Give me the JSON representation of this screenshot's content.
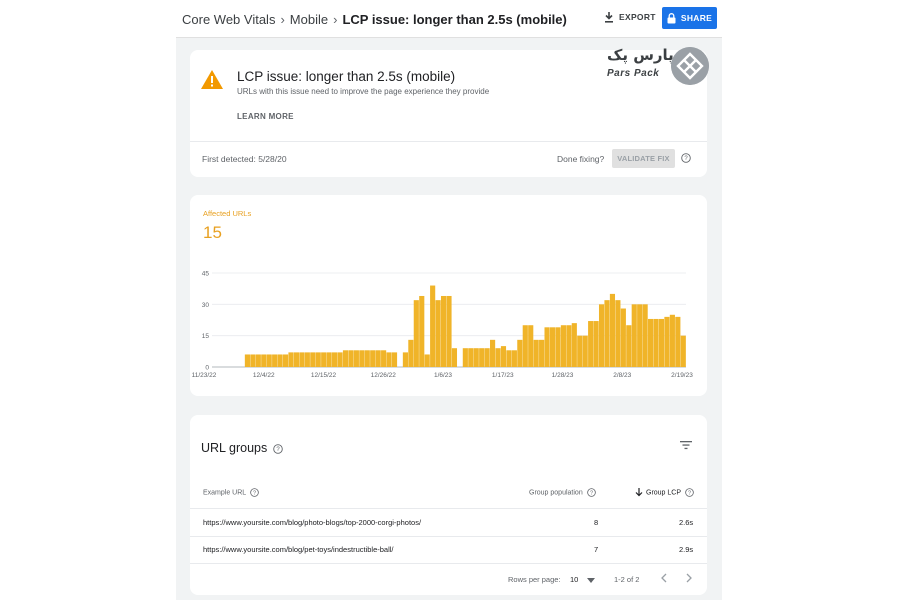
{
  "breadcrumb": [
    "Core Web Vitals",
    "Mobile",
    "LCP issue: longer than 2.5s (mobile)"
  ],
  "toolbar": {
    "export_label": "EXPORT",
    "share_label": "SHARE"
  },
  "issue": {
    "title": "LCP issue: longer than 2.5s (mobile)",
    "description": "URLs with this issue need to improve the page experience they provide",
    "learn_more": "LEARN MORE",
    "first_detected": "First detected: 5/28/20",
    "done_fixing": "Done fixing?",
    "validate_label": "VALIDATE FIX"
  },
  "logo": {
    "persian_text": "پارس پک",
    "latin_text": "Pars Pack"
  },
  "summary": {
    "affected_label": "Affected URLs",
    "affected_value": "15"
  },
  "colors": {
    "accent": "#1a73e8",
    "bar": "#f0b429",
    "warning": "#f29900"
  },
  "chart_data": {
    "type": "bar",
    "yticks": [
      0,
      15,
      30,
      45
    ],
    "ylim": [
      0,
      45
    ],
    "xticks": [
      "11/23/22",
      "12/4/22",
      "12/15/22",
      "12/26/22",
      "1/6/23",
      "1/17/23",
      "1/28/23",
      "2/8/23",
      "2/19/23"
    ],
    "values": [
      0,
      0,
      0,
      0,
      0,
      0,
      6,
      6,
      6,
      6,
      6,
      6,
      6,
      6,
      7,
      7,
      7,
      7,
      7,
      7,
      7,
      7,
      7,
      7,
      8,
      8,
      8,
      8,
      8,
      8,
      8,
      8,
      7,
      7,
      0,
      7,
      13,
      32,
      34,
      6,
      39,
      32,
      34,
      34,
      9,
      0,
      9,
      9,
      9,
      9,
      9,
      13,
      9,
      10,
      8,
      8,
      13,
      20,
      20,
      13,
      13,
      19,
      19,
      19,
      20,
      20,
      21,
      15,
      15,
      22,
      22,
      30,
      32,
      35,
      32,
      28,
      20,
      30,
      30,
      30,
      23,
      23,
      23,
      24,
      25,
      24,
      15
    ],
    "series": [
      {
        "values": []
      }
    ]
  },
  "url_groups": {
    "title": "URL groups",
    "columns": {
      "example": "Example URL",
      "population": "Group population",
      "lcp": "Group LCP"
    },
    "rows": [
      {
        "url": "https://www.yoursite.com/blog/photo-blogs/top-2000-corgi-photos/",
        "population": "8",
        "lcp": "2.6s"
      },
      {
        "url": "https://www.yoursite.com/blog/pet-toys/indestructible-ball/",
        "population": "7",
        "lcp": "2.9s"
      }
    ],
    "footer": {
      "rows_per_page_label": "Rows per page:",
      "rows_per_page": "10",
      "range": "1-2 of 2"
    }
  }
}
